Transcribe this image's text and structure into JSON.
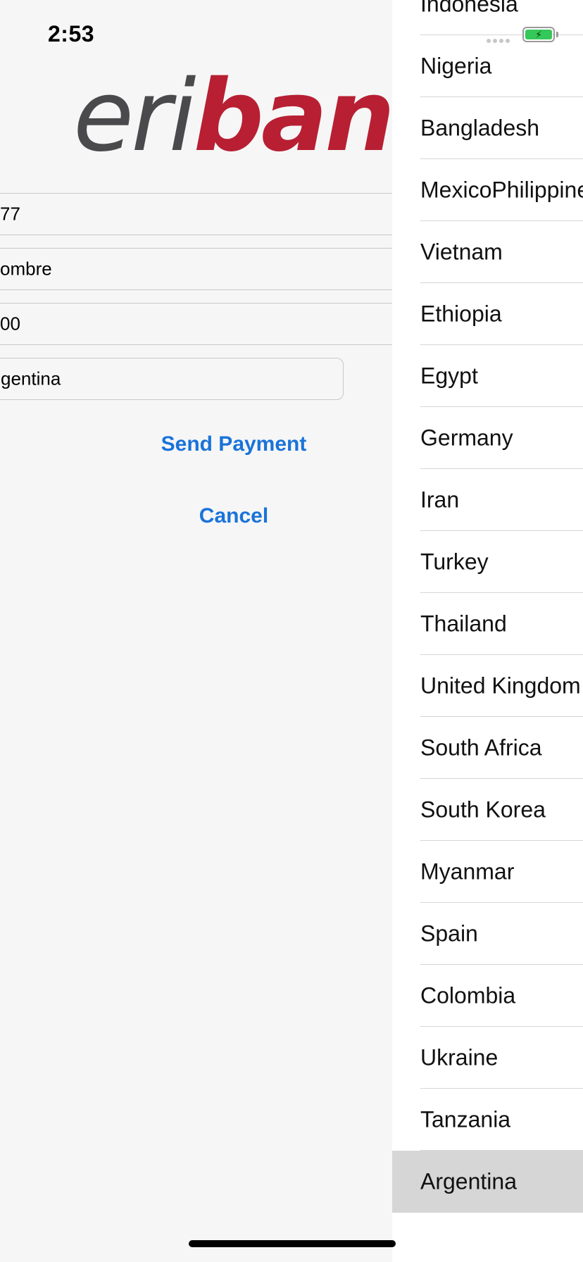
{
  "status_bar": {
    "time": "2:53",
    "battery_icon": "battery-charging-icon",
    "signal_icon": "signal-dots-icon",
    "battery_color": "#34c759"
  },
  "logo": {
    "part1": "eri",
    "part2": "bank",
    "color_part1": "#4a4a4c",
    "color_part2": "#b81f33"
  },
  "form": {
    "field1_value": "77",
    "field2_value": "ombre",
    "field3_value": "00",
    "country_value": "gentina"
  },
  "actions": {
    "send_label": "Send Payment",
    "cancel_label": "Cancel",
    "accent_color": "#1a73d9"
  },
  "picker": {
    "selected": "Argentina",
    "items": [
      "Indonesia",
      "Nigeria",
      "Bangladesh",
      "MexicoPhilippines",
      "Vietnam",
      "Ethiopia",
      "Egypt",
      "Germany",
      "Iran",
      "Turkey",
      "Thailand",
      "United Kingdom",
      "South Africa",
      "South Korea",
      "Myanmar",
      "Spain",
      "Colombia",
      "Ukraine",
      "Tanzania",
      "Argentina"
    ]
  }
}
